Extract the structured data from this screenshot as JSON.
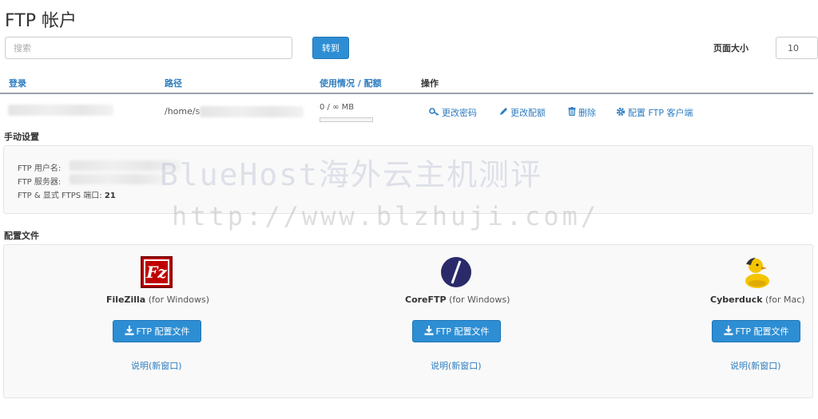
{
  "header": {
    "title": "FTP 帐户"
  },
  "search": {
    "placeholder": "搜索",
    "go_label": "转到"
  },
  "pagination": {
    "page_size_label": "页面大小",
    "page_size_value": "10"
  },
  "table": {
    "columns": {
      "login": "登录",
      "path": "路径",
      "usage": "使用情况 / 配额",
      "actions": "操作"
    },
    "row": {
      "path": "/home/s",
      "usage": "0 / ∞ MB",
      "usage_fraction": 0,
      "actions": {
        "change_password": "更改密码",
        "change_quota": "更改配额",
        "delete": "删除",
        "configure_client": "配置 FTP 客户端"
      }
    }
  },
  "manual_settings": {
    "title": "手动设置",
    "username_label": "FTP 用户名:",
    "server_label": "FTP 服务器:",
    "port_label": "FTP & 显式 FTPS 端口:",
    "port_value": "21"
  },
  "config_files": {
    "title": "配置文件",
    "clients": [
      {
        "name": "FileZilla",
        "platform": "(for Windows)",
        "button": "FTP 配置文件",
        "help": "说明(新窗口)",
        "logo_text": "Fz"
      },
      {
        "name": "CoreFTP",
        "platform": "(for Windows)",
        "button": "FTP 配置文件",
        "help": "说明(新窗口)"
      },
      {
        "name": "Cyberduck",
        "platform": "(for Mac)",
        "button": "FTP 配置文件",
        "help": "说明(新窗口)"
      }
    ]
  },
  "watermark": {
    "line1": "BlueHost海外云主机测评",
    "line2": "http://www.blzhuji.com/"
  },
  "icons": {
    "key": "key-icon",
    "pencil": "pencil-icon",
    "trash": "trash-icon",
    "gear": "gear-icon",
    "download": "download-icon"
  },
  "colors": {
    "primary": "#2d8ed4",
    "link": "#2d7dc0",
    "filezilla": "#bf0000",
    "coreftp": "#2a2a6a",
    "cyberduck": "#f5c400"
  }
}
